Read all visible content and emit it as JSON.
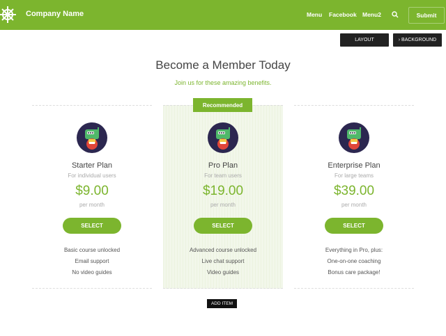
{
  "header": {
    "brand": "Company Name",
    "nav": [
      "Menu",
      "Facebook",
      "Menu2"
    ],
    "submit_label": "Submit"
  },
  "editor": {
    "layout_label": "LAYOUT",
    "background_label": "› BACKGROUND",
    "add_item_label": "ADD ITEM"
  },
  "section": {
    "title": "Become a Member Today",
    "subtitle": "Join us for these amazing benefits."
  },
  "badge": "Recommended",
  "plans": [
    {
      "name": "Starter Plan",
      "audience": "For individual users",
      "price": "$9.00",
      "period": "per month",
      "cta": "SELECT",
      "features": [
        "Basic course unlocked",
        "Email support",
        "No video guides"
      ]
    },
    {
      "name": "Pro Plan",
      "audience": "For team users",
      "price": "$19.00",
      "period": "per month",
      "cta": "SELECT",
      "features": [
        "Advanced course unlocked",
        "Live chat support",
        "Video guides"
      ]
    },
    {
      "name": "Enterprise Plan",
      "audience": "For large teams",
      "price": "$39.00",
      "period": "per month",
      "cta": "SELECT",
      "features": [
        "Everything in Pro, plus:",
        "One-on-one coaching",
        "Bonus care package!"
      ]
    }
  ],
  "colors": {
    "accent": "#7cb52e",
    "dark": "#222222"
  }
}
